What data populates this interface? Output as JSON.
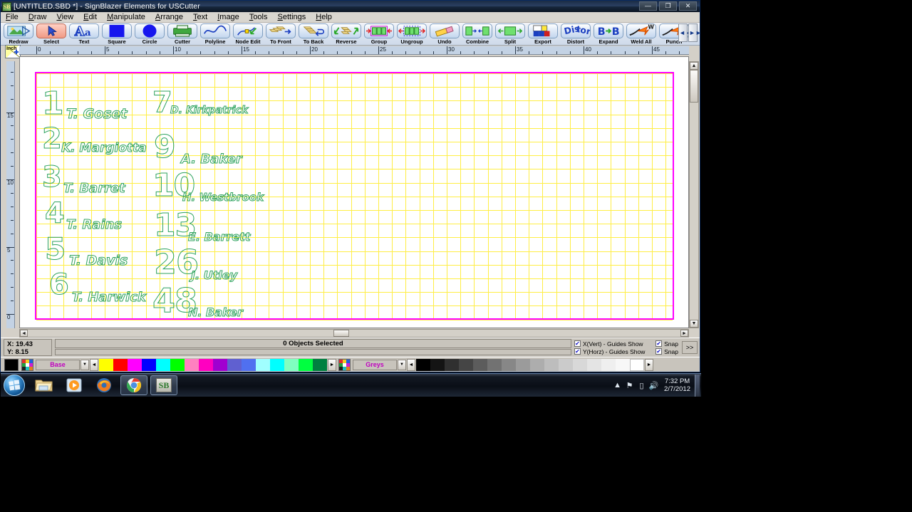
{
  "window": {
    "title": "[UNTITLED.SBD *] - SignBlazer Elements for USCutter",
    "icon": "sb-logo-icon",
    "buttons": {
      "minimize": "—",
      "maximize": "❐",
      "close": "✕"
    }
  },
  "menu": {
    "items": [
      "File",
      "Draw",
      "View",
      "Edit",
      "Manipulate",
      "Arrange",
      "Text",
      "Image",
      "Tools",
      "Settings",
      "Help"
    ]
  },
  "toolbar": {
    "tools": [
      {
        "label": "Redraw",
        "icon": "redraw-icon",
        "selected": false
      },
      {
        "label": "Select",
        "icon": "cursor-icon",
        "selected": true
      },
      {
        "label": "Text",
        "icon": "text-aa-icon",
        "selected": false
      },
      {
        "label": "Square",
        "icon": "square-icon",
        "selected": false
      },
      {
        "label": "Circle",
        "icon": "circle-icon",
        "selected": false
      },
      {
        "label": "Cutter",
        "icon": "cutter-icon",
        "selected": false
      },
      {
        "label": "Polyline",
        "icon": "polyline-icon",
        "selected": false
      },
      {
        "label": "Node Edit",
        "icon": "node-edit-icon",
        "selected": false
      },
      {
        "label": "To Front",
        "icon": "to-front-icon",
        "selected": false
      },
      {
        "label": "To Back",
        "icon": "to-back-icon",
        "selected": false
      },
      {
        "label": "Reverse",
        "icon": "reverse-icon",
        "selected": false
      },
      {
        "label": "Group",
        "icon": "group-icon",
        "selected": false
      },
      {
        "label": "Ungroup",
        "icon": "ungroup-icon",
        "selected": false
      },
      {
        "label": "Undo",
        "icon": "eraser-icon",
        "selected": false
      },
      {
        "label": "Combine",
        "icon": "combine-icon",
        "selected": false
      },
      {
        "label": "Split",
        "icon": "split-icon",
        "selected": false
      },
      {
        "label": "Export",
        "icon": "export-icon",
        "selected": false
      },
      {
        "label": "Distort",
        "icon": "distort-icon",
        "selected": false
      },
      {
        "label": "Expand",
        "icon": "expand-b-icon",
        "selected": false
      },
      {
        "label": "Weld All",
        "icon": "weld-all-icon",
        "selected": false
      },
      {
        "label": "Punch",
        "icon": "punch-icon",
        "selected": false
      }
    ],
    "nav_prev": "◄◄",
    "nav_next": "►►"
  },
  "rulers": {
    "unit_label": "Inch",
    "horizontal_labels": [
      "0",
      "5",
      "10",
      "15",
      "20",
      "25",
      "30",
      "35",
      "40",
      "45"
    ],
    "vertical_labels": [
      "15",
      "10",
      "5",
      "0"
    ]
  },
  "canvas": {
    "sheet_border_color": "#ff00ff",
    "grid_color": "#ffee44",
    "stroke_color": "#2fa35f",
    "entries_left": [
      {
        "number": "1",
        "name": "T. Goset"
      },
      {
        "number": "2",
        "name": "K. Margiotta"
      },
      {
        "number": "3",
        "name": "T. Barret"
      },
      {
        "number": "4",
        "name": "T. Rains"
      },
      {
        "number": "5",
        "name": "T. Davis"
      },
      {
        "number": "6",
        "name": "T. Harwick"
      }
    ],
    "entries_right": [
      {
        "number": "7",
        "name": "D. Kirkpatrick"
      },
      {
        "number": "9",
        "name": "A. Baker"
      },
      {
        "number": "10",
        "name": "H. Westbrook"
      },
      {
        "number": "13",
        "name": "E. Barrett"
      },
      {
        "number": "26",
        "name": "J. Utley"
      },
      {
        "number": "48",
        "name": "N. Baker"
      }
    ]
  },
  "status": {
    "x_label": "X:",
    "x_value": "19.43",
    "y_label": "Y:",
    "y_value": "8.15",
    "message": "0 Objects Selected",
    "message2": "",
    "guides": [
      {
        "label": "X(Vert) - Guides Show",
        "checked": true
      },
      {
        "label": "Y(Horz) - Guides Show",
        "checked": true
      }
    ],
    "snaps": [
      {
        "label": "Snap",
        "checked": true
      },
      {
        "label": "Snap",
        "checked": true
      }
    ],
    "more_button": ">>"
  },
  "palette": {
    "current_color": "#000000",
    "left_name": "Base",
    "right_name": "Greys",
    "dropdown_glyph": "▼",
    "prev_glyph": "◄",
    "next_glyph": "►",
    "base_colors": [
      "#ffff00",
      "#ff0000",
      "#ff00ff",
      "#0000ff",
      "#00ffff",
      "#00ff00",
      "#ff80c0",
      "#ff00c0",
      "#a000d0",
      "#6060d0",
      "#5070f0",
      "#a0ffff",
      "#00ffff",
      "#80ffc0",
      "#00ff40",
      "#008040"
    ],
    "grey_colors": [
      "#000000",
      "#141414",
      "#303030",
      "#454545",
      "#5c5c5c",
      "#727272",
      "#878787",
      "#9b9b9b",
      "#adadad",
      "#bdbdbd",
      "#cbcbcb",
      "#d8d8d8",
      "#e4e4e4",
      "#efefef",
      "#f7f7f7",
      "#ffffff"
    ]
  },
  "taskbar": {
    "start": "windows-orb-icon",
    "items": [
      {
        "name": "file-explorer-icon",
        "active": false
      },
      {
        "name": "media-player-icon",
        "active": false
      },
      {
        "name": "firefox-icon",
        "active": false
      },
      {
        "name": "chrome-icon",
        "active": true
      },
      {
        "name": "signblazer-icon",
        "active": true
      }
    ],
    "tray": {
      "show_hidden": "▲",
      "icons": [
        "network-flag-icon",
        "battery-icon",
        "volume-icon"
      ],
      "time": "7:32 PM",
      "date": "2/7/2012"
    }
  }
}
